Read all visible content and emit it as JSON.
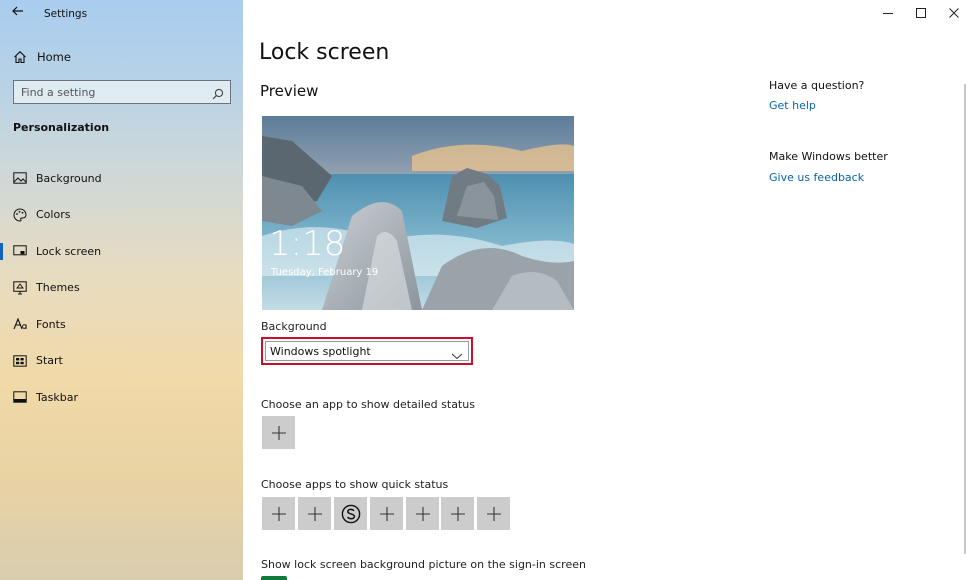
{
  "window": {
    "app_title": "Settings",
    "back_icon": "back-arrow-icon",
    "controls": {
      "minimize": "—",
      "maximize": "☐",
      "close": "✕"
    }
  },
  "sidebar": {
    "home_label": "Home",
    "search_placeholder": "Find a setting",
    "section_heading": "Personalization",
    "items": [
      {
        "label": "Background",
        "icon": "picture-icon",
        "active": false
      },
      {
        "label": "Colors",
        "icon": "palette-icon",
        "active": false
      },
      {
        "label": "Lock screen",
        "icon": "lock-screen-icon",
        "active": true
      },
      {
        "label": "Themes",
        "icon": "themes-icon",
        "active": false
      },
      {
        "label": "Fonts",
        "icon": "fonts-icon",
        "active": false
      },
      {
        "label": "Start",
        "icon": "start-icon",
        "active": false
      },
      {
        "label": "Taskbar",
        "icon": "taskbar-icon",
        "active": false
      }
    ]
  },
  "main": {
    "page_title": "Lock screen",
    "preview_heading": "Preview",
    "preview": {
      "time": "1:18",
      "date": "Tuesday, February 19"
    },
    "background_label": "Background",
    "background_value": "Windows spotlight",
    "detailed_status_heading": "Choose an app to show detailed status",
    "quick_status_heading": "Choose apps to show quick status",
    "quick_status_tiles": [
      "add",
      "add",
      "skype",
      "add",
      "add",
      "add",
      "add"
    ],
    "signin_heading": "Show lock screen background picture on the sign-in screen"
  },
  "right_panel": {
    "question_heading": "Have a question?",
    "get_help": "Get help",
    "better_heading": "Make Windows better",
    "feedback": "Give us feedback"
  },
  "colors": {
    "accent": "#1064c0",
    "link": "#0a64a8",
    "highlight_border": "#c8102e",
    "tile_bg": "#cccccc"
  }
}
